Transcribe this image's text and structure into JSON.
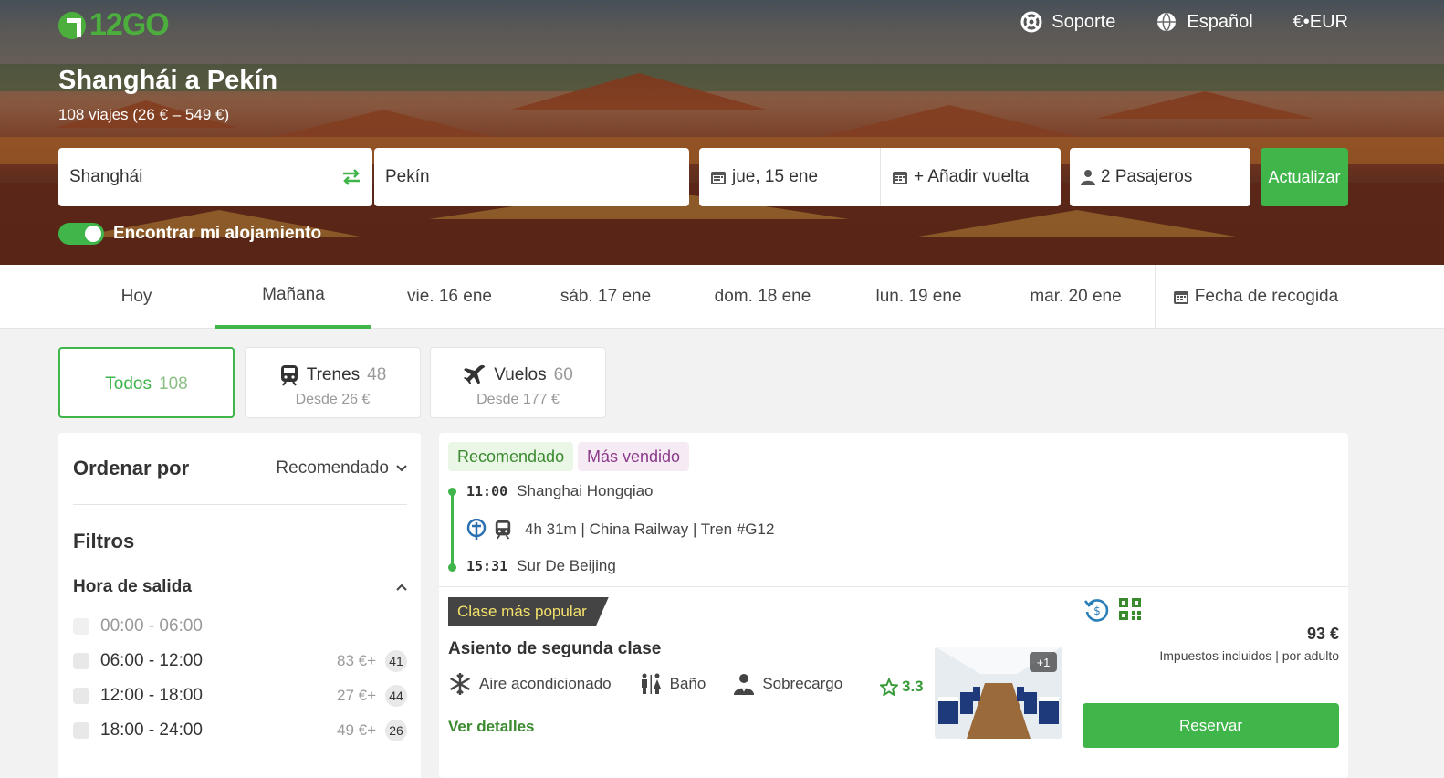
{
  "brand": {
    "logo_text": "12GO",
    "accent": "#3fb54a"
  },
  "topnav": {
    "support": "Soporte",
    "language": "Español",
    "currency": "€•EUR"
  },
  "hero": {
    "title": "Shanghái a Pekín",
    "subtitle": "108 viajes (26 € – 549 €)"
  },
  "search": {
    "from": "Shanghái",
    "to": "Pekín",
    "date": "jue, 15 ene",
    "return": "+ Añadir vuelta",
    "passengers": "2 Pasajeros",
    "update_label": "Actualizar"
  },
  "accommodation_toggle": {
    "label": "Encontrar mi alojamiento",
    "on": true
  },
  "date_tabs": [
    "Hoy",
    "Mañana",
    "vie. 16 ene",
    "sáb. 17 ene",
    "dom. 18 ene",
    "lun. 19 ene",
    "mar. 20 ene"
  ],
  "date_tab_active_index": 1,
  "date_picker_label": "Fecha de recogida",
  "modes": {
    "all": {
      "label": "Todos",
      "count": "108"
    },
    "trains": {
      "label": "Trenes",
      "count": "48",
      "from": "Desde 26 €"
    },
    "flights": {
      "label": "Vuelos",
      "count": "60",
      "from": "Desde 177 €"
    }
  },
  "sidebar": {
    "sort_label": "Ordenar por",
    "sort_value": "Recomendado",
    "filters_title": "Filtros",
    "departure_title": "Hora de salida",
    "time_ranges": [
      {
        "label": "00:00 - 06:00",
        "price": "",
        "count": "",
        "disabled": true
      },
      {
        "label": "06:00 - 12:00",
        "price": "83 €+",
        "count": "41",
        "disabled": false
      },
      {
        "label": "12:00 - 18:00",
        "price": "27 €+",
        "count": "44",
        "disabled": false
      },
      {
        "label": "18:00 - 24:00",
        "price": "49 €+",
        "count": "26",
        "disabled": false
      }
    ]
  },
  "result": {
    "tag_recommended": "Recomendado",
    "tag_bestseller": "Más vendido",
    "dep_time": "11:00",
    "dep_station": "Shanghai Hongqiao",
    "journey": "4h 31m | China Railway | Tren #G12",
    "arr_time": "15:31",
    "arr_station": "Sur De Beijing",
    "popular_label": "Clase más popular",
    "class_name": "Asiento de segunda clase",
    "amenities": [
      "Aire acondicionado",
      "Baño",
      "Sobrecargo"
    ],
    "rating": "3.3",
    "details_link": "Ver detalles",
    "photo_more": "+1",
    "price": "93 €",
    "price_note": "Impuestos incluidos | por adulto",
    "book_label": "Reservar"
  }
}
